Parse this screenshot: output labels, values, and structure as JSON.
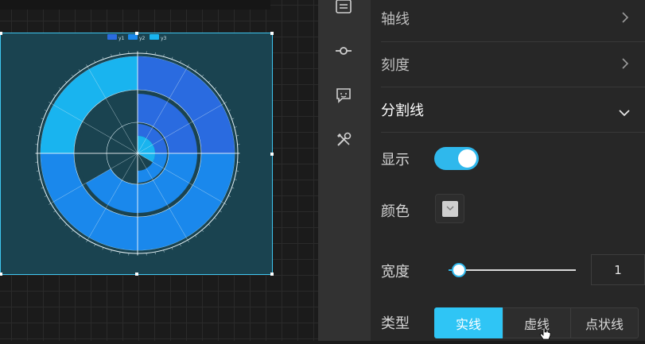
{
  "panel": {
    "sections": [
      {
        "label": "轴线",
        "expanded": false
      },
      {
        "label": "刻度",
        "expanded": false
      },
      {
        "label": "分割线",
        "expanded": true
      }
    ],
    "show_label": "显示",
    "show_enabled": true,
    "color_label": "颜色",
    "width_label": "宽度",
    "width_value": "1",
    "width_slider_level": 0.05,
    "type_label": "类型",
    "type_options": [
      "实线",
      "虚线",
      "点状线"
    ],
    "type_selected": "实线"
  },
  "toolbar": {
    "icons": [
      "list-icon",
      "commit-node-icon",
      "chat-emoji-icon",
      "tools-icon"
    ]
  },
  "chart_preview": {
    "legend": [
      "y1",
      "y2",
      "y3"
    ],
    "colors": {
      "series1": "#2a6be0",
      "series2": "#1a88ec",
      "series3": "#19b4ef"
    }
  },
  "colors": {
    "accent": "#2fb8ec",
    "panel_bg": "#272727",
    "toolbar_bg": "#323232",
    "chart_bg": "#1a4350"
  }
}
